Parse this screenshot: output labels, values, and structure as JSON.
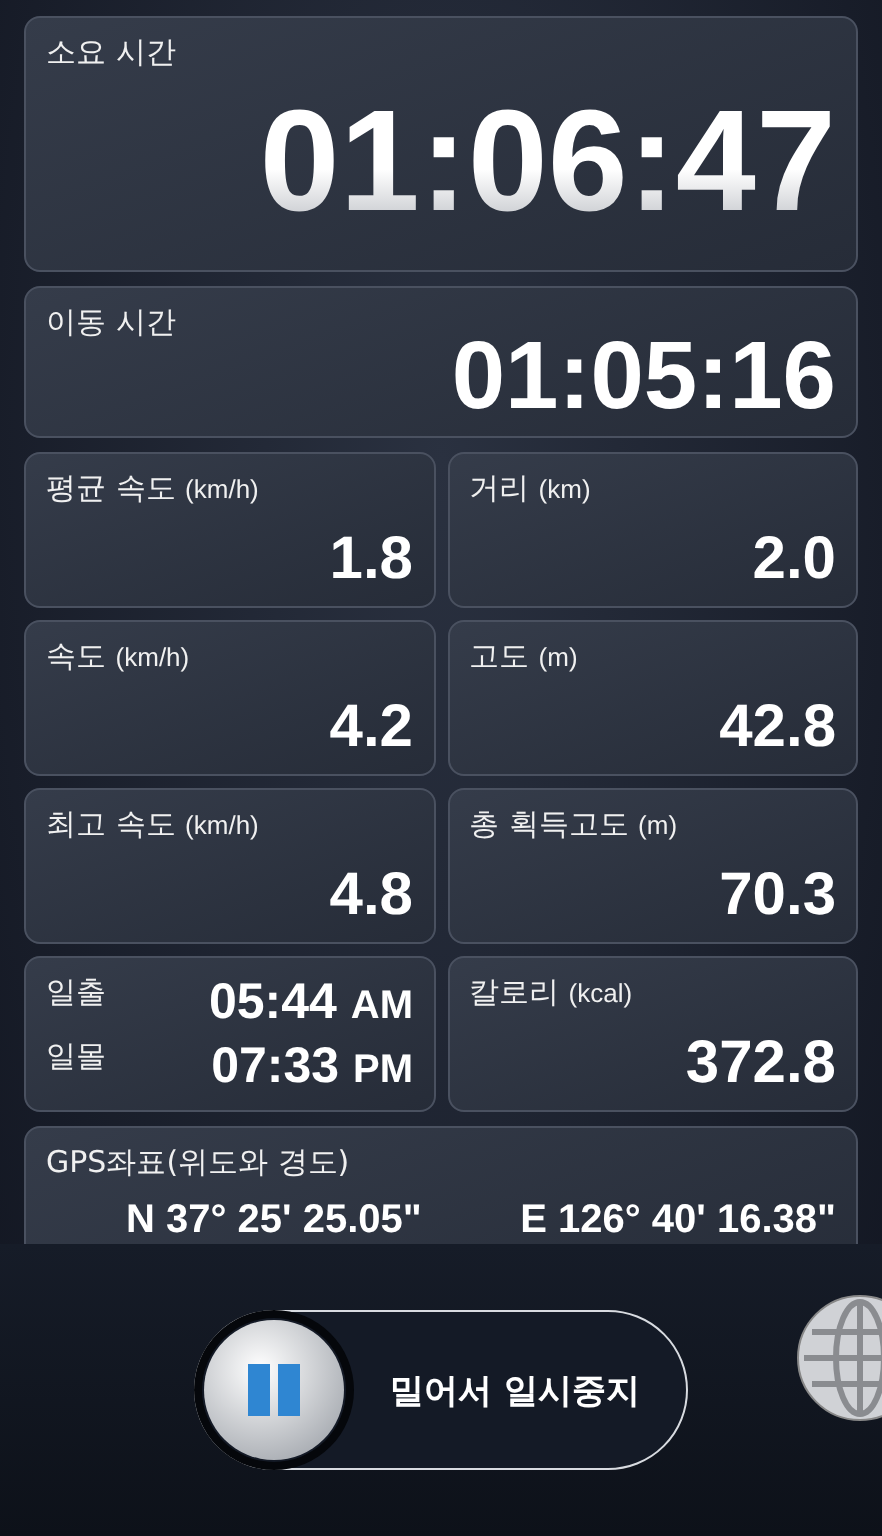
{
  "total_time": {
    "label": "소요 시간",
    "value": "01:06:47"
  },
  "moving_time": {
    "label": "이동 시간",
    "value": "01:05:16"
  },
  "stats": [
    {
      "kind": "metric",
      "label": "평균 속도",
      "unit": "(km/h)",
      "value": "1.8"
    },
    {
      "kind": "metric",
      "label": "거리",
      "unit": "(km)",
      "value": "2.0"
    },
    {
      "kind": "metric",
      "label": "속도",
      "unit": "(km/h)",
      "value": "4.2"
    },
    {
      "kind": "metric",
      "label": "고도",
      "unit": "(m)",
      "value": "42.8"
    },
    {
      "kind": "metric",
      "label": "최고 속도",
      "unit": "(km/h)",
      "value": "4.8"
    },
    {
      "kind": "metric",
      "label": "총 획득고도",
      "unit": "(m)",
      "value": "70.3"
    },
    {
      "kind": "sun",
      "rows": [
        {
          "label": "일출",
          "time": "05:44",
          "suffix": "AM"
        },
        {
          "label": "일몰",
          "time": "07:33",
          "suffix": "PM"
        }
      ]
    },
    {
      "kind": "metric",
      "label": "칼로리",
      "unit": "(kcal)",
      "value": "372.8"
    }
  ],
  "gps": {
    "label": "GPS좌표(위도와 경도)",
    "latitude": "N 37° 25' 25.05\"",
    "longitude": "E 126° 40' 16.38\""
  },
  "slider": {
    "label": "밀어서 일시중지",
    "level": 0
  }
}
